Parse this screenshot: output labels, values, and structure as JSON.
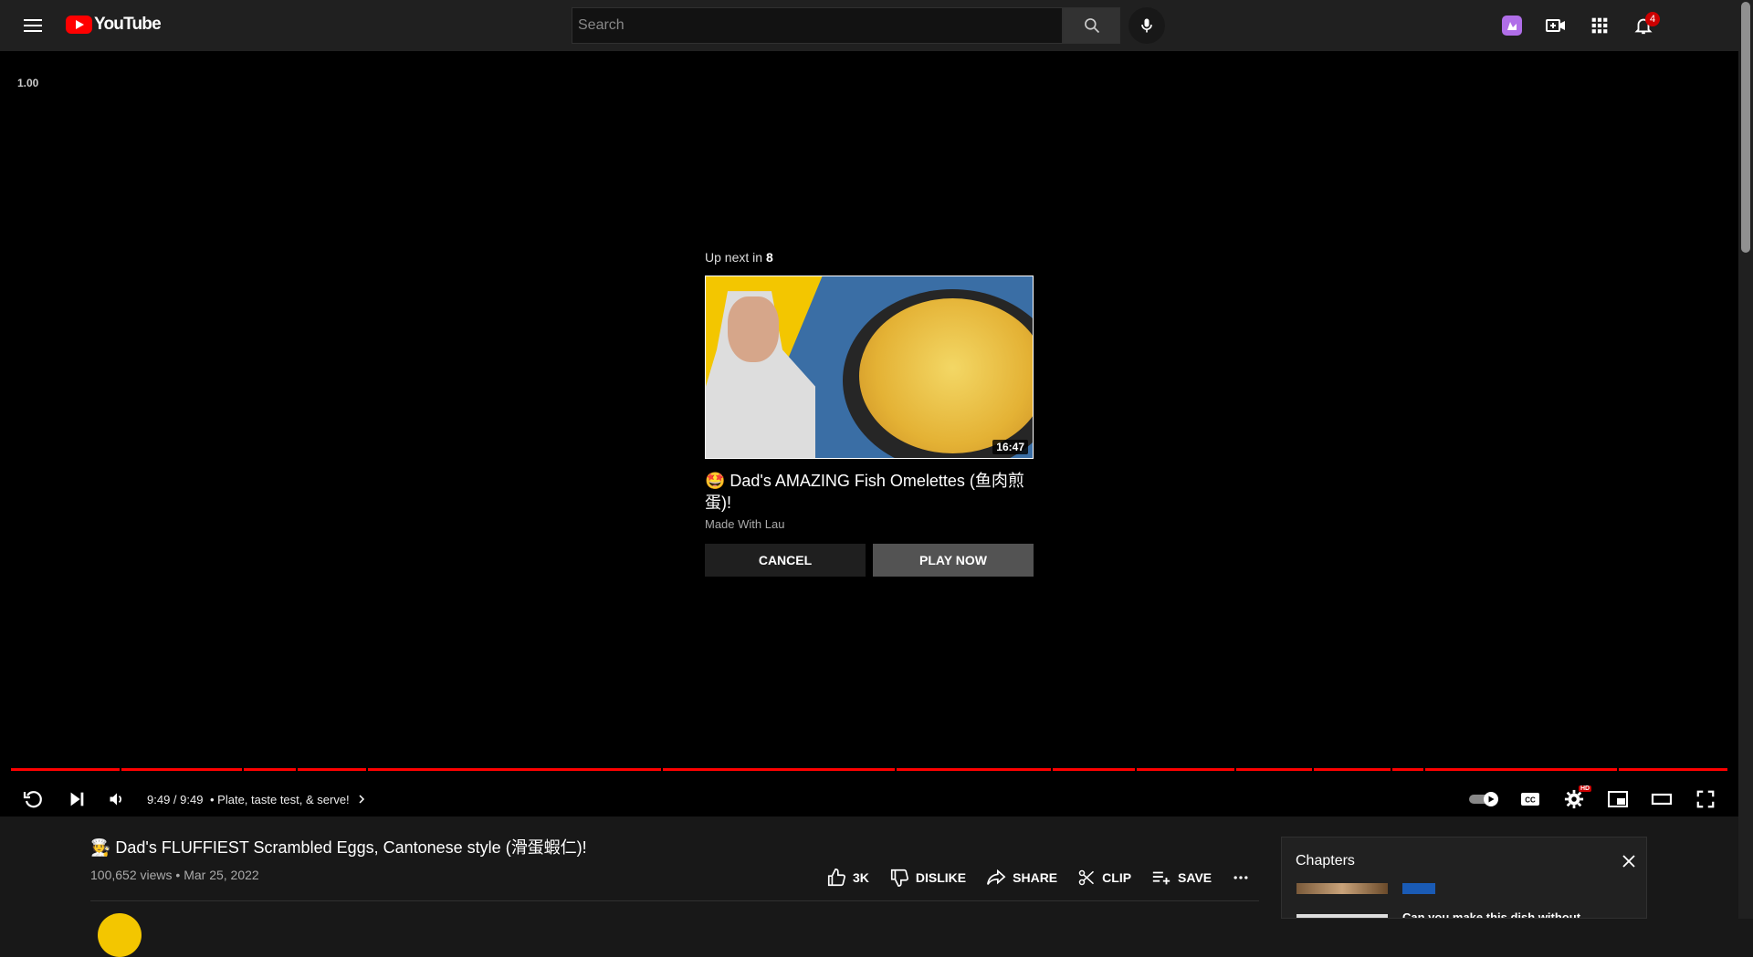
{
  "masthead": {
    "logo_text": "YouTube",
    "search_placeholder": "Search",
    "notification_count": "4"
  },
  "player": {
    "playback_speed": "1.00",
    "up_next": {
      "label": "Up next in ",
      "countdown": "8",
      "duration": "16:47",
      "title": "🤩 Dad's AMAZING Fish Omelettes (鱼肉煎蛋)!",
      "channel": "Made With Lau",
      "cancel_label": "CANCEL",
      "play_label": "PLAY NOW"
    },
    "progress_fraction": 1.0,
    "time_display": "9:49 / 9:49",
    "chapter_title": "• Plate, taste test, & serve!",
    "hd_badge": "HD"
  },
  "video": {
    "title": "🧑‍🍳 Dad's FLUFFIEST Scrambled Eggs, Cantonese style (滑蛋蝦仁)!",
    "views": "100,652 views",
    "date": "Mar 25, 2022",
    "actions": {
      "like": "3K",
      "dislike": "DISLIKE",
      "share": "SHARE",
      "clip": "CLIP",
      "save": "SAVE"
    }
  },
  "chapters": {
    "title": "Chapters",
    "partial_item_title": "Can you make this dish without"
  },
  "colors": {
    "brand_red": "#ff0000",
    "masthead_bg": "#202020",
    "player_bg": "#000000"
  }
}
